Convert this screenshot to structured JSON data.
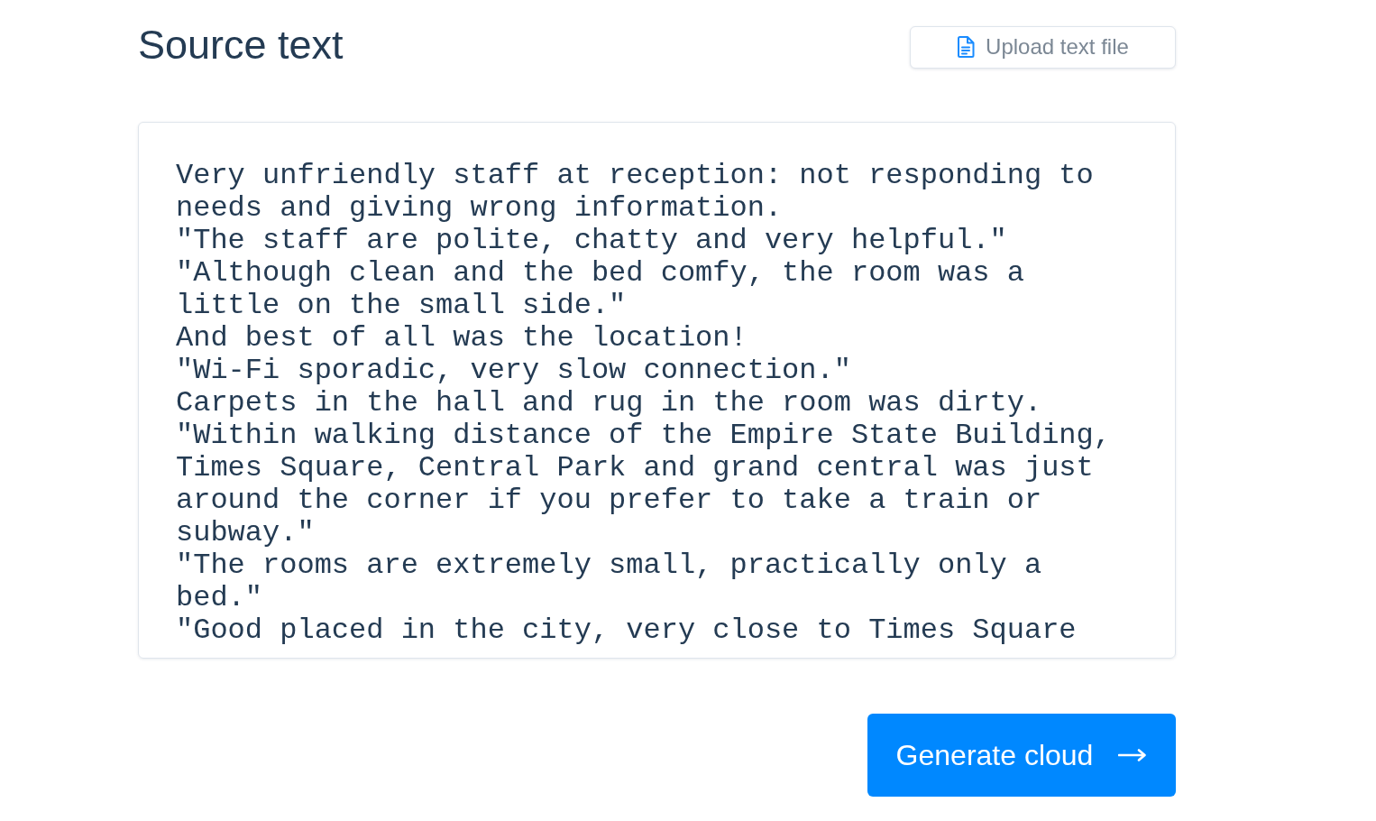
{
  "header": {
    "title": "Source text",
    "upload_button": {
      "label": "Upload text file"
    }
  },
  "source_text": {
    "value": "Very unfriendly staff at reception: not responding to needs and giving wrong information.\n\"The staff are polite, chatty and very helpful.\"\n\"Although clean and the bed comfy, the room was a little on the small side.\"\nAnd best of all was the location!\n\"Wi-Fi sporadic, very slow connection.\"\nCarpets in the hall and rug in the room was dirty.\n\"Within walking distance of the Empire State Building, Times Square, Central Park and grand central was just around the corner if you prefer to take a train or subway.\"\n\"The rooms are extremely small, practically only a bed.\"\n\"Good placed in the city, very close to Times Square"
  },
  "generate_button": {
    "label": "Generate cloud"
  }
}
